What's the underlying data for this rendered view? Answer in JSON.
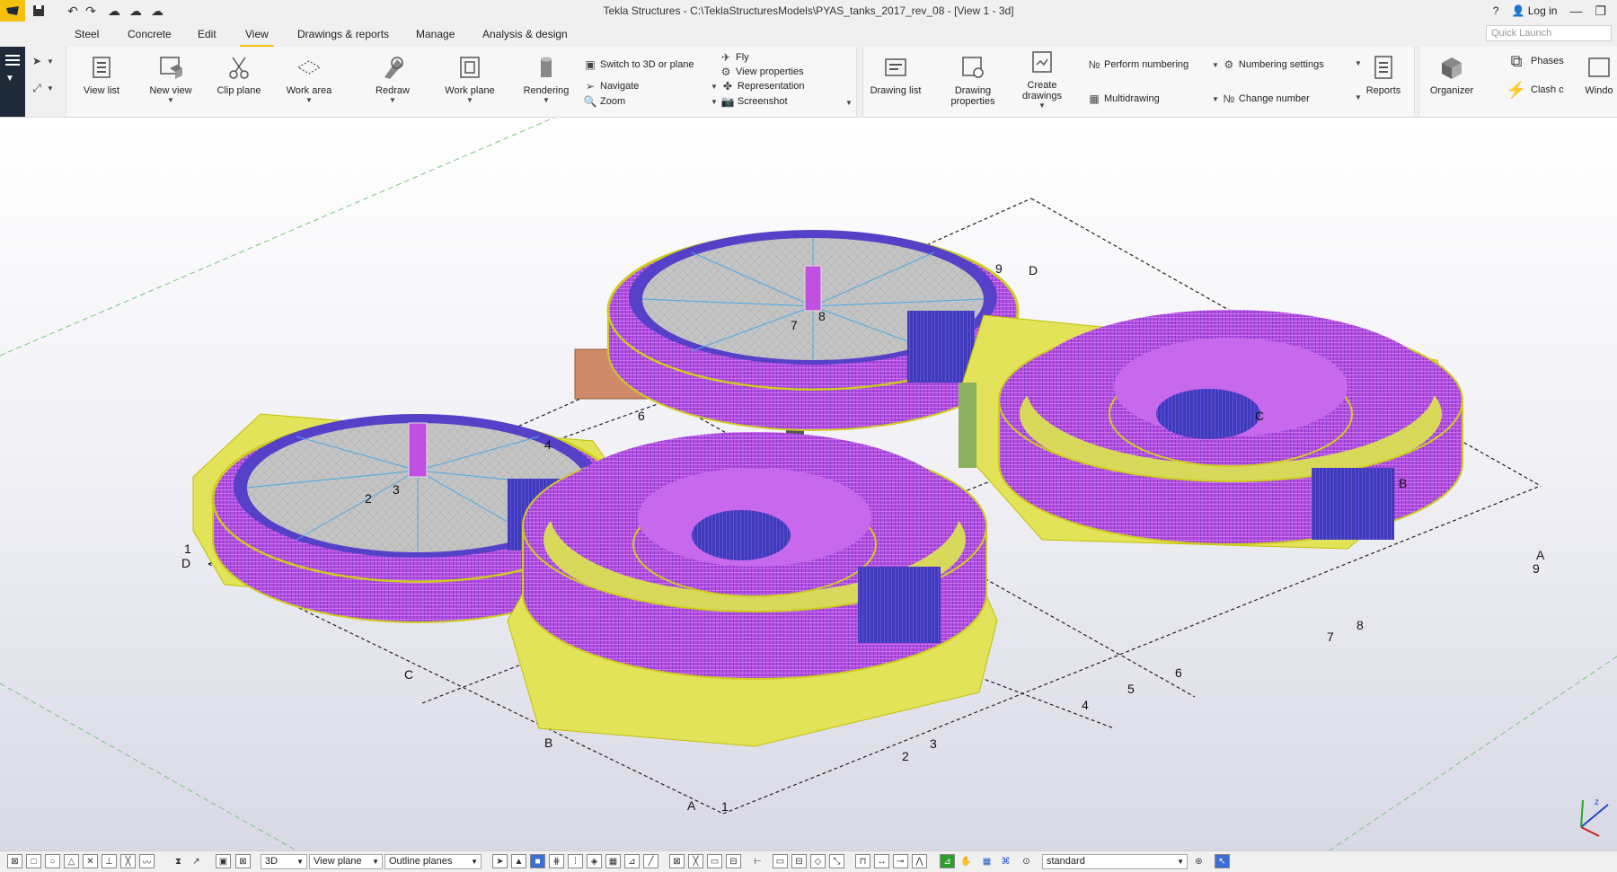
{
  "titlebar": {
    "title": "Tekla Structures - C:\\TeklaStructuresModels\\PYAS_tanks_2017_rev_08  - [View 1 - 3d]",
    "help": "?",
    "login": "Log in"
  },
  "tabs": [
    "Steel",
    "Concrete",
    "Edit",
    "View",
    "Drawings & reports",
    "Manage",
    "Analysis & design"
  ],
  "quick_launch_placeholder": "Quick Launch",
  "ribbon": {
    "view_list": "View list",
    "new_view": "New view",
    "clip_plane": "Clip plane",
    "work_area": "Work area",
    "redraw": "Redraw",
    "work_plane": "Work plane",
    "rendering": "Rendering",
    "switch_3d": "Switch to 3D or plane",
    "navigate": "Navigate",
    "zoom": "Zoom",
    "fly": "Fly",
    "view_properties": "View properties",
    "representation": "Representation",
    "screenshot": "Screenshot",
    "drawing_list": "Drawing list",
    "drawing_properties_1": "Drawing",
    "drawing_properties_2": "properties",
    "create_drawings_1": "Create",
    "create_drawings_2": "drawings",
    "perform_numbering": "Perform numbering",
    "multidrawing": "Multidrawing",
    "numbering_settings": "Numbering settings",
    "change_number": "Change number",
    "reports": "Reports",
    "organizer": "Organizer",
    "phases": "Phases",
    "clash": "Clash c",
    "windows": "Windo"
  },
  "grid_labels": {
    "top": [
      "D",
      "9",
      "6",
      "1",
      "D",
      "4",
      "2",
      "3",
      "7",
      "8",
      "C"
    ],
    "bottom": [
      "C",
      "B",
      "A",
      "1",
      "2",
      "3",
      "4",
      "5",
      "6",
      "7",
      "8",
      "B",
      "A",
      "9"
    ]
  },
  "statusbar": {
    "view_mode": "3D",
    "plane": "View plane",
    "outline": "Outline planes",
    "standard": "standard"
  },
  "colors": {
    "accent": "#f4c20d",
    "leftbar": "#1e2a38",
    "wall": "#b04ee0",
    "wall_dark": "#4b3db8",
    "rim": "#e6e62a",
    "floor": "#b8b8b8"
  }
}
